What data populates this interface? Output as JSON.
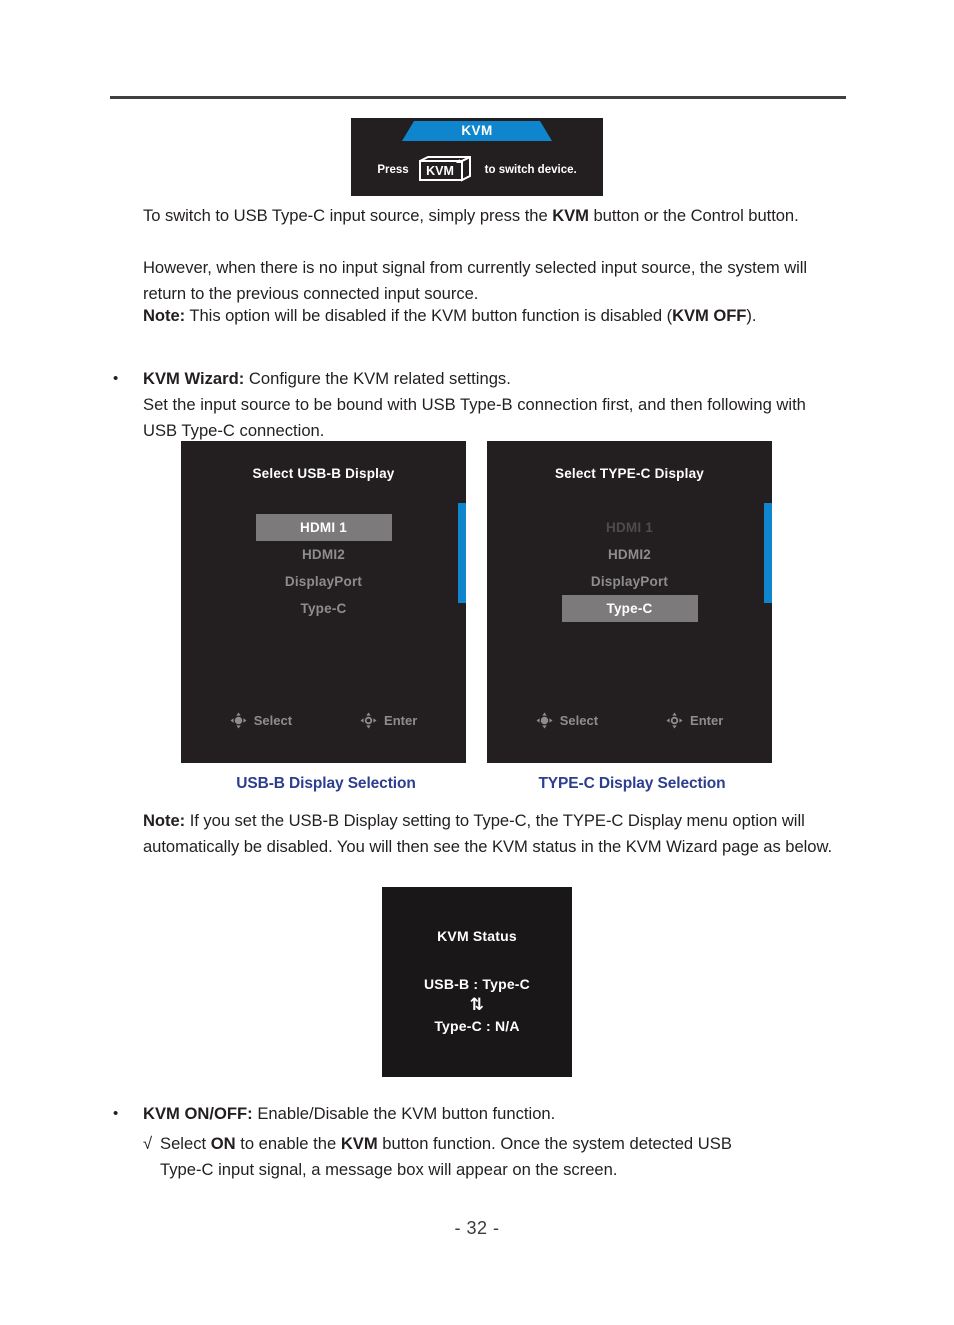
{
  "page": {
    "number_label": "- 32 -"
  },
  "kvm_message": {
    "banner_label": "KVM",
    "press_label": "Press",
    "key_label": "KVM",
    "suffix_label": "to switch device."
  },
  "body": {
    "para1_line1_a": "To switch to USB Type-C input source, simply press the ",
    "para1_bold1": "KVM",
    "para1_line1_b": " button or the Control button.",
    "para1_line2": "However, when there is no input signal from currently selected input source, the system will return to the previous connected input source.",
    "para1_note_label": "Note:",
    "para1_note_text": " This option will be disabled if the KVM button function is disabled (",
    "para1_note_bold": "KVM OFF",
    "para1_note_tail": ").",
    "bullet1_marker": "•",
    "bullet1_bold": "KVM Wizard:",
    "bullet1_text": " Configure the KVM related settings.",
    "bullet1_line2": "Set the input source to be bound with USB Type-B connection first, and then following with USB Type-C connection.",
    "note2_label": "Note:",
    "note2_text": " If you set the USB-B Display setting to Type-C, the TYPE-C Display menu option will automatically be disabled. You will then see the KVM status in the KVM Wizard page as below.",
    "bullet2_marker": "•",
    "bullet2_bold": "KVM ON/OFF:",
    "bullet2_text": " Enable/Disable the KVM button function.",
    "sub2_marker": "√",
    "sub2_a": "Select ",
    "sub2_bold1": "ON",
    "sub2_b": " to enable the ",
    "sub2_bold2": "KVM",
    "sub2_c": " button function. Once the system detected USB Type-C input signal, a message box will appear on the screen."
  },
  "osd_usb_b": {
    "title": "Select USB-B Display",
    "items": [
      {
        "label": "HDMI 1",
        "state": "selected"
      },
      {
        "label": "HDMI2",
        "state": "normal"
      },
      {
        "label": "DisplayPort",
        "state": "normal"
      },
      {
        "label": "Type-C",
        "state": "normal"
      }
    ],
    "footer": [
      {
        "label": "Select",
        "icon": "joystick-select-icon"
      },
      {
        "label": "Enter",
        "icon": "joystick-enter-icon"
      }
    ],
    "caption": "USB-B Display Selection"
  },
  "osd_type_c": {
    "title": "Select TYPE-C Display",
    "items": [
      {
        "label": "HDMI 1",
        "state": "dim"
      },
      {
        "label": "HDMI2",
        "state": "normal"
      },
      {
        "label": "DisplayPort",
        "state": "normal"
      },
      {
        "label": "Type-C",
        "state": "selected"
      }
    ],
    "footer": [
      {
        "label": "Select",
        "icon": "joystick-select-icon"
      },
      {
        "label": "Enter",
        "icon": "joystick-enter-icon"
      }
    ],
    "caption": "TYPE-C Display Selection"
  },
  "kvm_status": {
    "title": "KVM Status",
    "line1": "USB-B : Type-C",
    "arrow": "⇅",
    "line2": "Type-C : N/A"
  },
  "colors": {
    "accent_blue": "#0f85cd",
    "caption_blue": "#2c3e8f",
    "osd_background": "#231f20",
    "osd_selected": "#7d7a7b",
    "osd_text": "#8d8d8d",
    "osd_dim": "#4e4b4c"
  }
}
